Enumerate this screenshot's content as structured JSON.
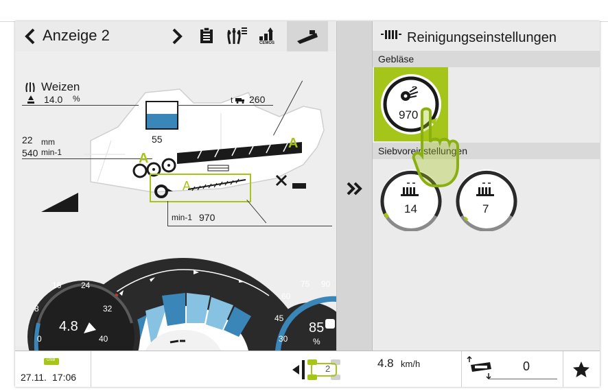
{
  "header": {
    "title": "Anzeige 2",
    "prev_icon": "chevron-left-icon",
    "next_icon": "chevron-right-icon",
    "icons": [
      "clipboard-icon",
      "crop-list-icon",
      "cemos-icon",
      "header-machine-icon"
    ],
    "cemos_label": "CEMOS"
  },
  "crop": {
    "name": "Weizen",
    "moisture": "14.0",
    "moisture_unit": "%"
  },
  "machine": {
    "tank_percent": "55",
    "throughput_unit": "t",
    "throughput": "260",
    "concave_gap": "22",
    "concave_unit": "mm",
    "drum_speed": "540",
    "drum_unit": "min-1",
    "fan_unit": "min-1",
    "fan_speed": "970",
    "auto_label": "A"
  },
  "right": {
    "title": "Reinigungseinstellungen",
    "section_fan": "Gebläse",
    "fan_value": "970",
    "section_sieve": "Siebvoreinstellungen",
    "sieve_upper": "14",
    "sieve_lower": "7",
    "expand_icon": "double-chevron-right-icon"
  },
  "gauges": {
    "speed_ticks": [
      "0",
      "8",
      "16",
      "24",
      "32",
      "40"
    ],
    "speed_value": "4.8",
    "load_ticks": [
      "30",
      "45",
      "60",
      "75",
      "90"
    ],
    "load_value": "85",
    "load_unit": "%"
  },
  "status": {
    "usb_label": "USB",
    "date": "27.11.",
    "time": "17:06",
    "gear": "2",
    "speed_value": "4.8",
    "speed_unit": "km/h",
    "header_height_value": "0",
    "favorite_icon": "star-icon"
  },
  "colors": {
    "accent_green": "#a6c51a",
    "gauge_blue": "#3a86b8",
    "gauge_light_blue": "#87c2e2",
    "dark_gauge": "#2a2a2a"
  }
}
